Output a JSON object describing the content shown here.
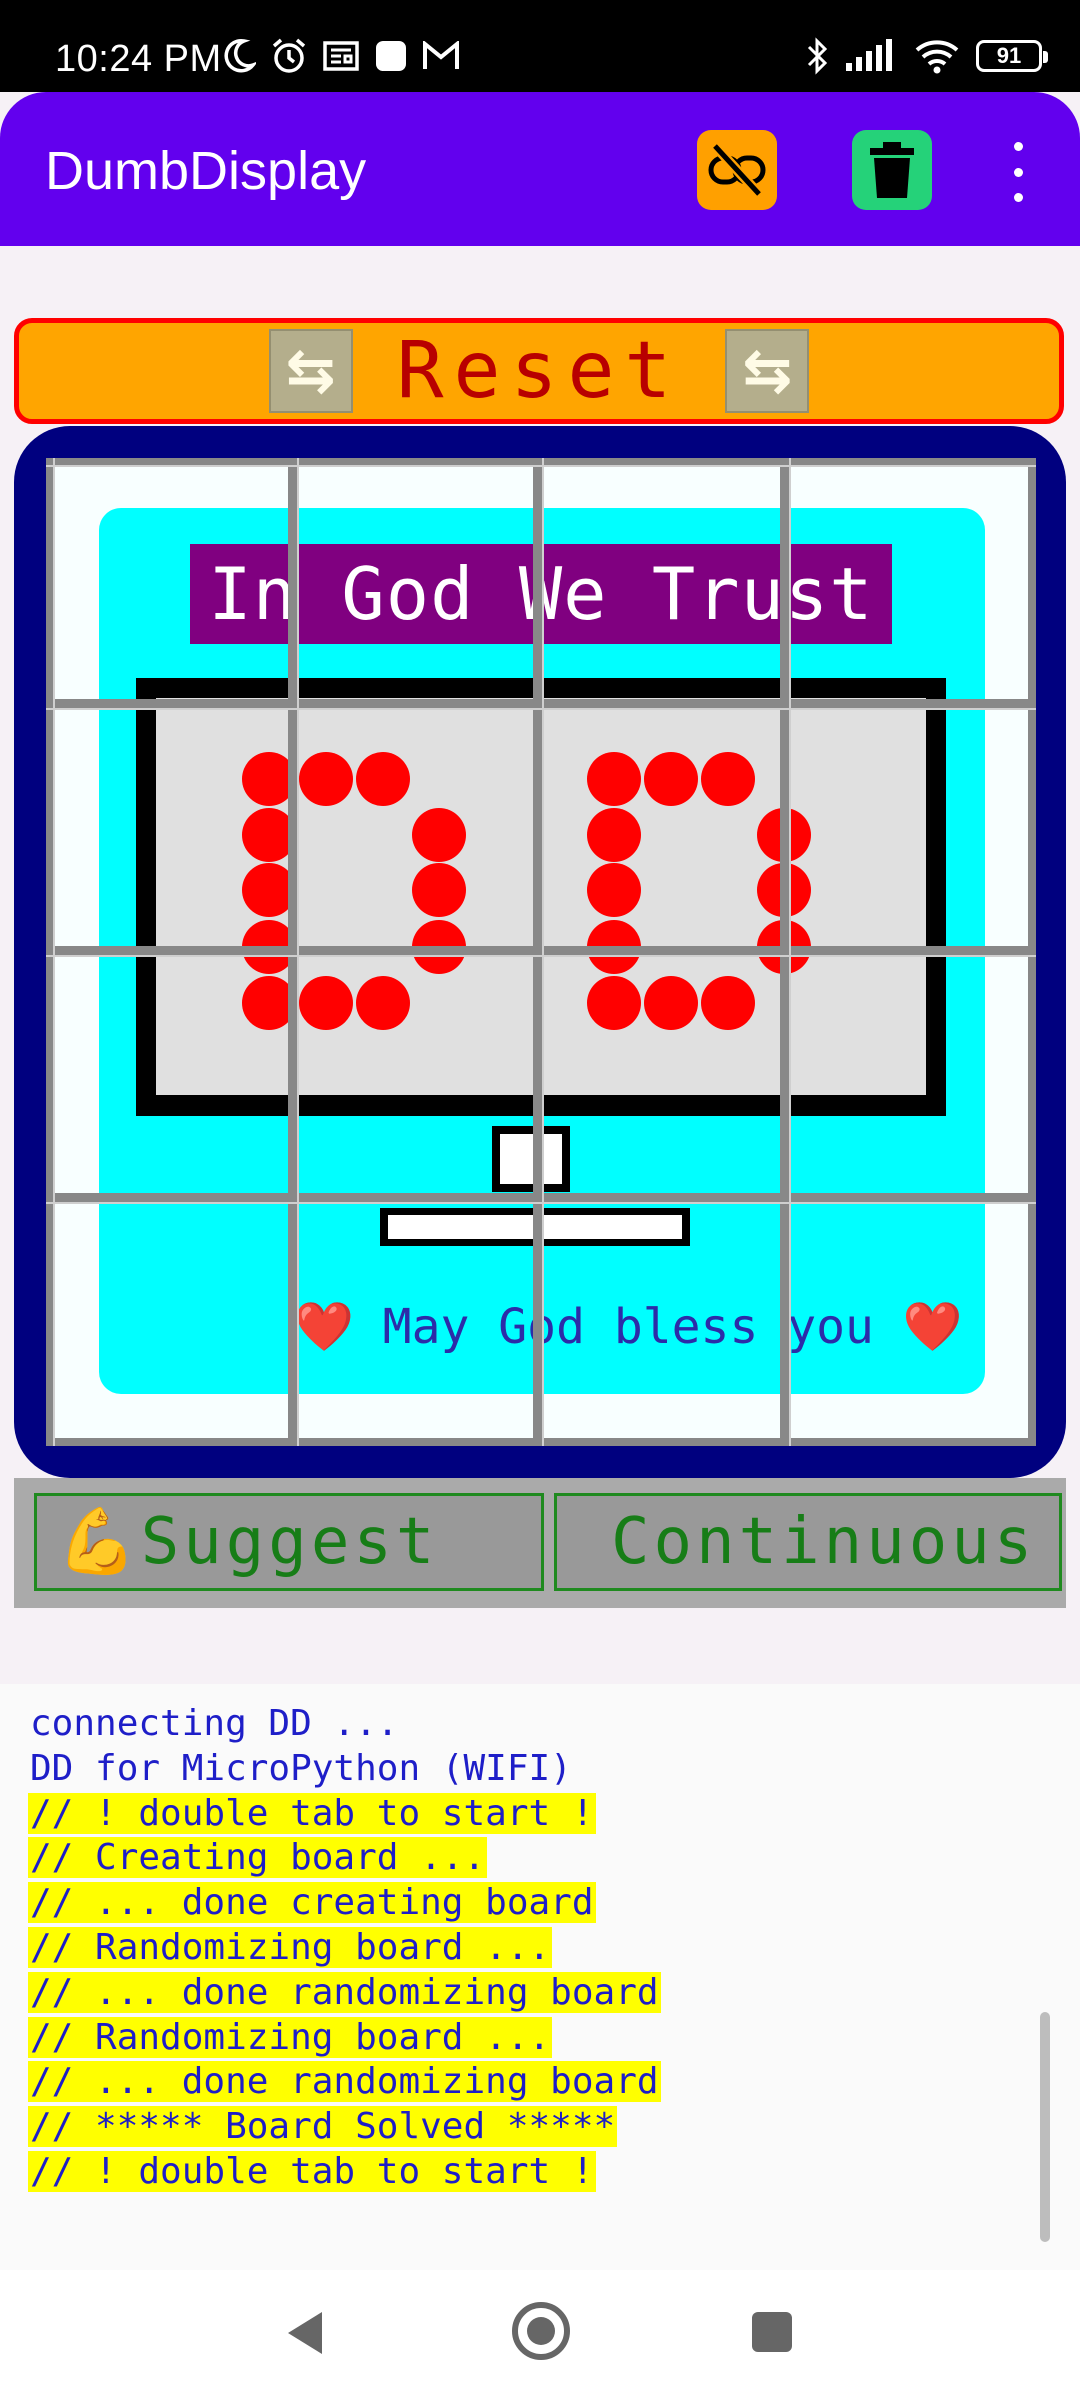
{
  "status_bar": {
    "time": "10:24 PM",
    "left_icons": [
      "moon-icon",
      "alarm-icon",
      "news-icon",
      "square-icon",
      "gmail-icon"
    ],
    "right_icons": [
      "bluetooth-icon",
      "signal-icon",
      "wifi-icon"
    ],
    "battery": "91"
  },
  "app_bar": {
    "title": "DumbDisplay",
    "buttons": [
      "link-off-icon",
      "trash-icon",
      "more-vert-icon"
    ],
    "colors": {
      "background": "#6200ee",
      "link_button": "#ffa000",
      "trash_button": "#25d279"
    }
  },
  "reset": {
    "label": "Reset",
    "icon": "refresh-icon"
  },
  "board": {
    "headline": "In God We Trust",
    "display_digits": "00",
    "blessing": "May God bless you",
    "heart": "❤️",
    "grid": "4x4"
  },
  "controls": {
    "suggest_icon": "💪",
    "suggest": "Suggest",
    "continuous": "Continuous"
  },
  "log": {
    "lines": [
      {
        "text": "connecting DD ...",
        "highlight": false
      },
      {
        "text": "DD for MicroPython (WIFI)",
        "highlight": false
      },
      {
        "text": "// ! double tab to start !",
        "highlight": true
      },
      {
        "text": "// Creating board ...",
        "highlight": true
      },
      {
        "text": "// ... done creating board",
        "highlight": true
      },
      {
        "text": "// Randomizing board ...",
        "highlight": true
      },
      {
        "text": "// ... done randomizing board",
        "highlight": true
      },
      {
        "text": "// Randomizing board ...",
        "highlight": true
      },
      {
        "text": "// ... done randomizing board",
        "highlight": true
      },
      {
        "text": "// ***** Board Solved *****",
        "highlight": true
      },
      {
        "text": "// ! double tab to start !",
        "highlight": true
      }
    ]
  },
  "nav_bar": {
    "buttons": [
      "back-icon",
      "home-icon",
      "recents-icon"
    ]
  }
}
